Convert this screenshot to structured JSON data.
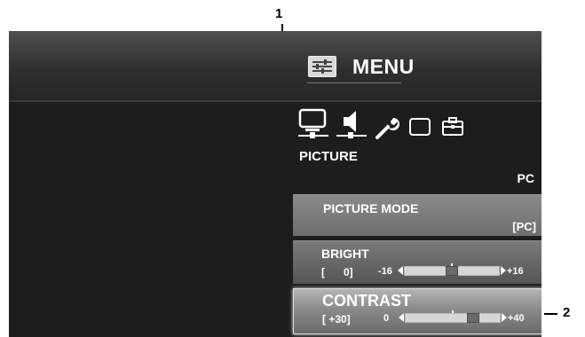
{
  "callouts": {
    "one": "1",
    "two": "2"
  },
  "menu": {
    "title": "MENU",
    "icon": "menu-settings-icon"
  },
  "category_icons": [
    {
      "name": "picture-monitor-icon",
      "selected": true
    },
    {
      "name": "audio-speaker-icon",
      "selected": false
    },
    {
      "name": "setup-wrench-icon",
      "selected": false
    },
    {
      "name": "screen-window-icon",
      "selected": false
    },
    {
      "name": "option-toolbox-icon",
      "selected": false
    }
  ],
  "category_label": "PICTURE",
  "input_label": "PC",
  "items": {
    "picture_mode": {
      "label": "PICTURE MODE",
      "value": "[PC]"
    },
    "bright": {
      "label": "BRIGHT",
      "value_prefix": "[",
      "value": "0]",
      "min": "-16",
      "max": "+16",
      "level": 0,
      "range": [
        -16,
        16
      ]
    },
    "contrast": {
      "label": "CONTRAST",
      "value": "[ +30]",
      "min": "0",
      "max": "+40",
      "level": 30,
      "range": [
        0,
        40
      ]
    }
  },
  "colors": {
    "panel_bg": "#1d1d1d",
    "text": "#ffffff",
    "track": "#d6d6d6",
    "thumb": "#6b6b6b"
  }
}
